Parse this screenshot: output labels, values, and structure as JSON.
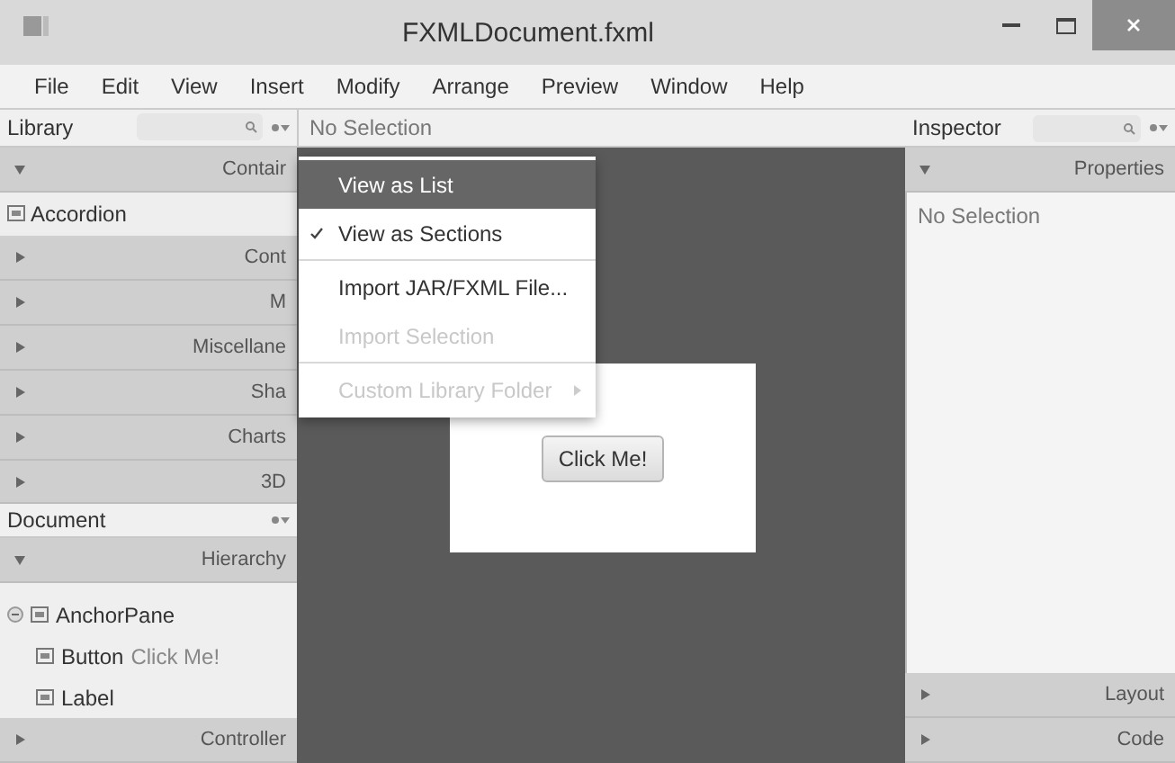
{
  "window": {
    "title": "FXMLDocument.fxml"
  },
  "menu_bar": [
    "File",
    "Edit",
    "View",
    "Insert",
    "Modify",
    "Arrange",
    "Preview",
    "Window",
    "Help"
  ],
  "library": {
    "title": "Library",
    "sections": [
      {
        "label": "Contair",
        "expanded": true,
        "items": [
          "Accordion"
        ]
      },
      {
        "label": "Cont",
        "expanded": false
      },
      {
        "label": "M",
        "expanded": false
      },
      {
        "label": "Miscellane",
        "expanded": false
      },
      {
        "label": "Sha",
        "expanded": false
      },
      {
        "label": "Charts",
        "expanded": false
      },
      {
        "label": "3D",
        "expanded": false
      }
    ]
  },
  "document": {
    "title": "Document",
    "sections": [
      {
        "label": "Hierarchy",
        "expanded": true,
        "tree": [
          {
            "label": "AnchorPane",
            "expanded": true,
            "children": [
              {
                "label": "Button",
                "detail": "Click Me!"
              },
              {
                "label": "Label"
              }
            ]
          }
        ]
      },
      {
        "label": "Controller",
        "expanded": false
      }
    ]
  },
  "canvas": {
    "breadcrumb": "No Selection",
    "button": "Click Me!"
  },
  "library_menu": [
    {
      "kind": "item",
      "label": "View as List",
      "highlighted": true,
      "checked": false,
      "disabled": false,
      "submenu": false
    },
    {
      "kind": "item",
      "label": "View as Sections",
      "highlighted": false,
      "checked": true,
      "disabled": false,
      "submenu": false
    },
    {
      "kind": "separator"
    },
    {
      "kind": "item",
      "label": "Import JAR/FXML File...",
      "highlighted": false,
      "checked": false,
      "disabled": false,
      "submenu": false
    },
    {
      "kind": "item",
      "label": "Import Selection",
      "highlighted": false,
      "checked": false,
      "disabled": true,
      "submenu": false
    },
    {
      "kind": "separator"
    },
    {
      "kind": "item",
      "label": "Custom Library Folder",
      "highlighted": false,
      "checked": false,
      "disabled": true,
      "submenu": true
    }
  ],
  "inspector": {
    "title": "Inspector",
    "sections": [
      {
        "label": "Properties",
        "expanded": true,
        "content": "No Selection"
      },
      {
        "label": "Layout",
        "expanded": false
      },
      {
        "label": "Code",
        "expanded": false
      }
    ]
  }
}
